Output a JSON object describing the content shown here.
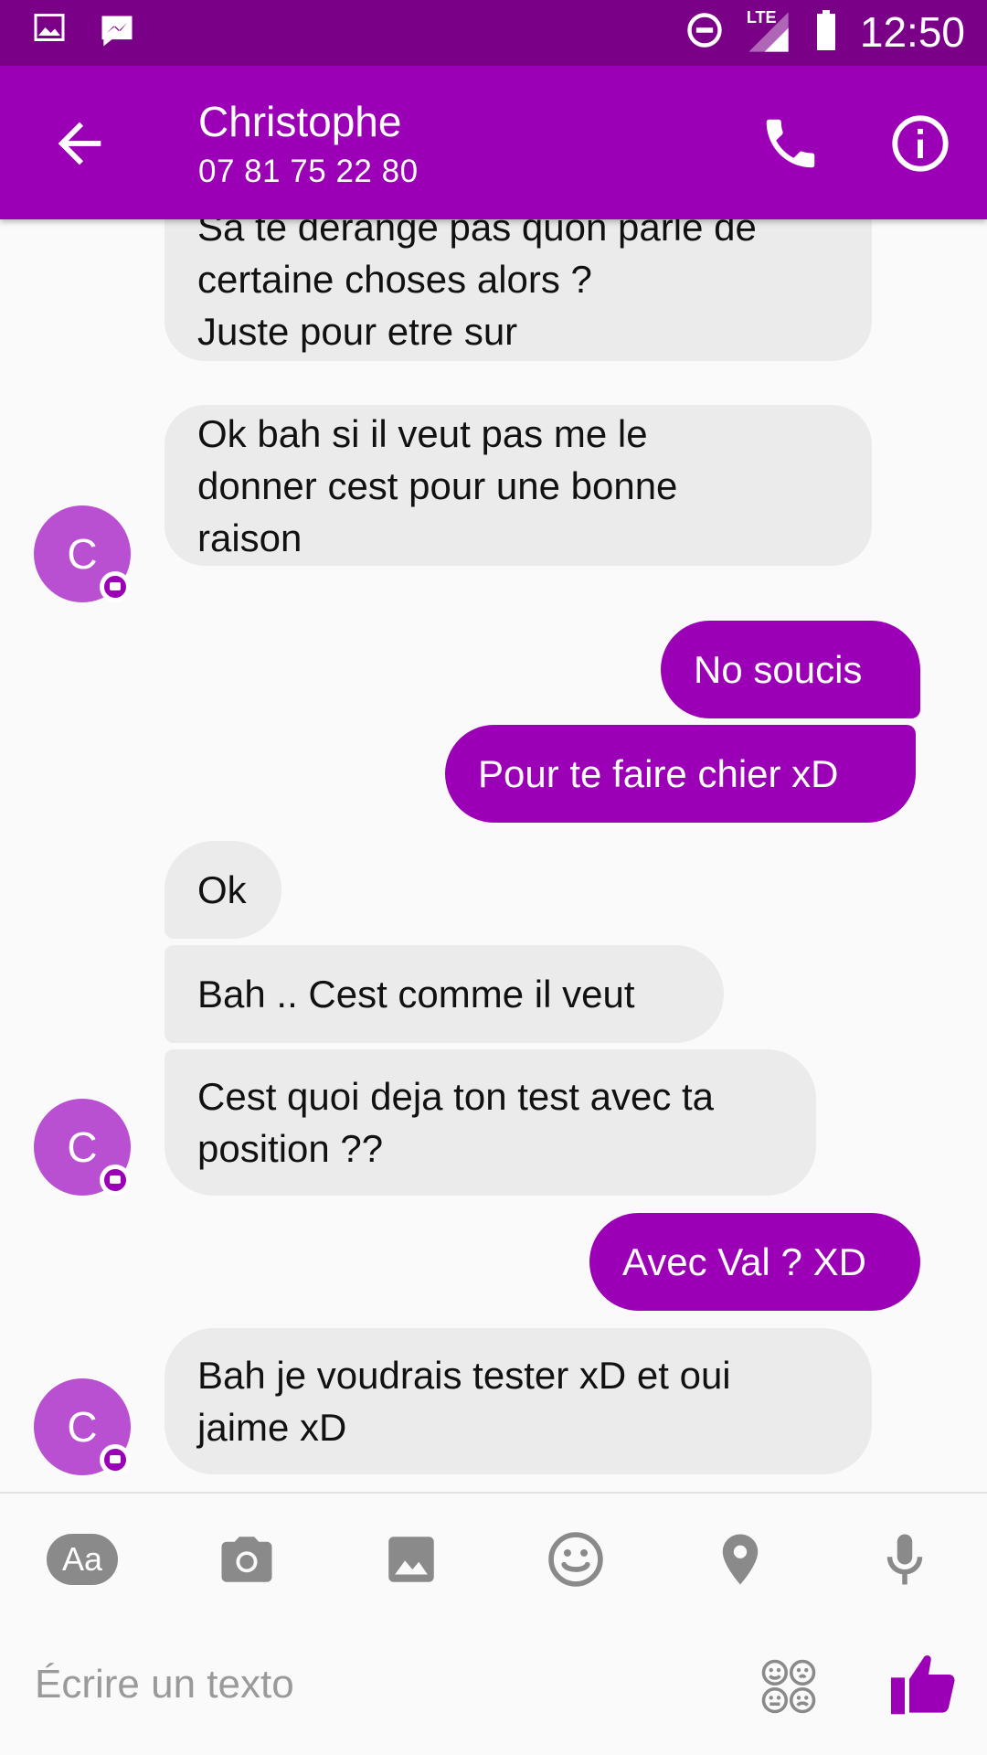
{
  "status_bar": {
    "time": "12:50",
    "network_label": "LTE",
    "icons": [
      "gallery-icon",
      "messenger-icon",
      "dnd-icon",
      "signal-icon",
      "battery-icon"
    ]
  },
  "header": {
    "contact_name": "Christophe",
    "contact_phone": "07 81 75 22 80",
    "icons": [
      "back-arrow-icon",
      "phone-icon",
      "info-icon"
    ]
  },
  "colors": {
    "status_bar": "#7b0088",
    "accent": "#9b00b6",
    "avatar": "#b94fd1",
    "incoming_bubble": "#ebebeb"
  },
  "avatar_initial": "C",
  "messages": [
    {
      "from": "contact",
      "text": "Sa te derange pas quon parle de\ncertaine choses alors ?\nJuste pour etre sur"
    },
    {
      "from": "contact",
      "text": "Ok bah si il veut pas me le\ndonner cest pour une bonne\nraison"
    },
    {
      "from": "me",
      "text": "No soucis"
    },
    {
      "from": "me",
      "text": "Pour te faire chier xD"
    },
    {
      "from": "contact",
      "text": "Ok"
    },
    {
      "from": "contact",
      "text": "Bah .. Cest comme il veut"
    },
    {
      "from": "contact",
      "text": "Cest quoi deja ton test avec ta\nposition ??"
    },
    {
      "from": "me",
      "text": "Avec Val ? XD"
    },
    {
      "from": "contact",
      "text": "Bah je voudrais tester xD et oui\njaime xD"
    }
  ],
  "toolbar": {
    "text_format_label": "Aa",
    "icons": [
      "text-format-icon",
      "camera-icon",
      "image-icon",
      "emoji-icon",
      "location-icon",
      "microphone-icon"
    ]
  },
  "composer": {
    "placeholder": "Écrire un texto",
    "value": "",
    "icons": [
      "sticker-icon",
      "thumbs-up-icon"
    ]
  }
}
